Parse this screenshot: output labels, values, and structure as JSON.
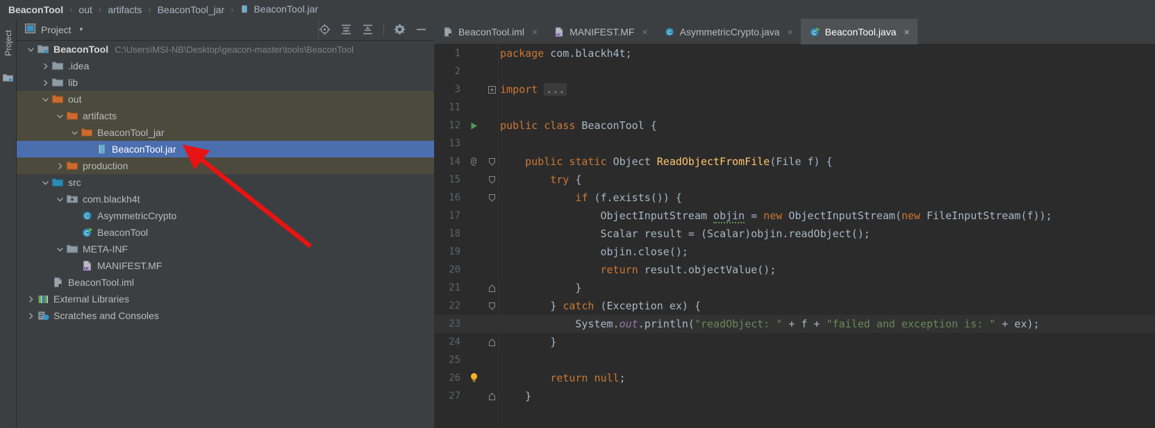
{
  "breadcrumb": {
    "items": [
      {
        "label": "BeaconTool",
        "bold": true,
        "icon": "none"
      },
      {
        "label": "out",
        "bold": false,
        "icon": "none"
      },
      {
        "label": "artifacts",
        "bold": false,
        "icon": "none"
      },
      {
        "label": "BeaconTool_jar",
        "bold": false,
        "icon": "none"
      },
      {
        "label": "BeaconTool.jar",
        "bold": false,
        "icon": "jar-icon"
      }
    ],
    "separator": "›"
  },
  "left_rail": {
    "label": "Project",
    "icon": "project-icon"
  },
  "project_panel": {
    "title": "Project",
    "dropdown_arrow": "▾",
    "toolbar_icons": [
      {
        "name": "locate-icon",
        "tooltip": "Select Opened File"
      },
      {
        "name": "expand-all-icon",
        "tooltip": "Expand All"
      },
      {
        "name": "collapse-all-icon",
        "tooltip": "Collapse All"
      },
      {
        "name": "gear-icon",
        "tooltip": "Settings"
      },
      {
        "name": "minimize-icon",
        "tooltip": "Hide"
      }
    ]
  },
  "tree": {
    "rows": [
      {
        "indent": 0,
        "arrow": "down",
        "icon": "module-icon",
        "label": "BeaconTool",
        "bold": true,
        "path": "C:\\Users\\MSI-NB\\Desktop\\geacon-master\\tools\\BeaconTool",
        "state": "normal"
      },
      {
        "indent": 1,
        "arrow": "right",
        "icon": "folder-gray",
        "label": ".idea",
        "bold": false,
        "path": "",
        "state": "normal"
      },
      {
        "indent": 1,
        "arrow": "right",
        "icon": "folder-gray",
        "label": "lib",
        "bold": false,
        "path": "",
        "state": "normal"
      },
      {
        "indent": 1,
        "arrow": "down",
        "icon": "folder-orange",
        "label": "out",
        "bold": false,
        "path": "",
        "state": "tint"
      },
      {
        "indent": 2,
        "arrow": "down",
        "icon": "folder-orange",
        "label": "artifacts",
        "bold": false,
        "path": "",
        "state": "tint"
      },
      {
        "indent": 3,
        "arrow": "down",
        "icon": "folder-orange",
        "label": "BeaconTool_jar",
        "bold": false,
        "path": "",
        "state": "tint"
      },
      {
        "indent": 4,
        "arrow": "none",
        "icon": "jar-icon",
        "label": "BeaconTool.jar",
        "bold": false,
        "path": "",
        "state": "selected"
      },
      {
        "indent": 2,
        "arrow": "right",
        "icon": "folder-orange",
        "label": "production",
        "bold": false,
        "path": "",
        "state": "tint"
      },
      {
        "indent": 1,
        "arrow": "down",
        "icon": "folder-blue",
        "label": "src",
        "bold": false,
        "path": "",
        "state": "normal"
      },
      {
        "indent": 2,
        "arrow": "down",
        "icon": "package-icon",
        "label": "com.blackh4t",
        "bold": false,
        "path": "",
        "state": "normal"
      },
      {
        "indent": 3,
        "arrow": "none",
        "icon": "class-icon",
        "label": "AsymmetricCrypto",
        "bold": false,
        "path": "",
        "state": "normal"
      },
      {
        "indent": 3,
        "arrow": "none",
        "icon": "class-run-icon",
        "label": "BeaconTool",
        "bold": false,
        "path": "",
        "state": "normal"
      },
      {
        "indent": 2,
        "arrow": "down",
        "icon": "folder-gray",
        "label": "META-INF",
        "bold": false,
        "path": "",
        "state": "normal"
      },
      {
        "indent": 3,
        "arrow": "none",
        "icon": "manifest-icon",
        "label": "MANIFEST.MF",
        "bold": false,
        "path": "",
        "state": "normal"
      },
      {
        "indent": 1,
        "arrow": "none",
        "icon": "iml-icon",
        "label": "BeaconTool.iml",
        "bold": false,
        "path": "",
        "state": "normal"
      },
      {
        "indent": 0,
        "arrow": "right",
        "icon": "libraries-icon",
        "label": "External Libraries",
        "bold": false,
        "path": "",
        "state": "normal"
      },
      {
        "indent": 0,
        "arrow": "right",
        "icon": "scratches-icon",
        "label": "Scratches and Consoles",
        "bold": false,
        "path": "",
        "state": "normal"
      }
    ]
  },
  "editor": {
    "tabs": [
      {
        "label": "BeaconTool.iml",
        "icon": "iml-icon",
        "active": false,
        "close": "×"
      },
      {
        "label": "MANIFEST.MF",
        "icon": "manifest-icon",
        "active": false,
        "close": "×"
      },
      {
        "label": "AsymmetricCrypto.java",
        "icon": "class-icon",
        "active": false,
        "close": "×"
      },
      {
        "label": "BeaconTool.java",
        "icon": "class-run-icon",
        "active": true,
        "close": "×"
      }
    ],
    "lines": [
      {
        "num": "1",
        "gutter": "",
        "fold": "",
        "current": false,
        "tokens": [
          {
            "t": "package ",
            "c": "kw"
          },
          {
            "t": "com.blackh4t;",
            "c": "plain"
          }
        ]
      },
      {
        "num": "2",
        "gutter": "",
        "fold": "",
        "current": false,
        "tokens": []
      },
      {
        "num": "3",
        "gutter": "",
        "fold": "plus",
        "current": false,
        "tokens": [
          {
            "t": "import ",
            "c": "kw"
          },
          {
            "t": "...",
            "c": "foldph"
          }
        ]
      },
      {
        "num": "11",
        "gutter": "",
        "fold": "",
        "current": false,
        "tokens": []
      },
      {
        "num": "12",
        "gutter": "run",
        "fold": "",
        "current": false,
        "tokens": [
          {
            "t": "public class ",
            "c": "kw"
          },
          {
            "t": "BeaconTool",
            "c": "cls"
          },
          {
            "t": " {",
            "c": "plain"
          }
        ]
      },
      {
        "num": "13",
        "gutter": "",
        "fold": "",
        "current": false,
        "tokens": []
      },
      {
        "num": "14",
        "gutter": "at",
        "fold": "down",
        "current": false,
        "tokens": [
          {
            "t": "    ",
            "c": "plain"
          },
          {
            "t": "public static ",
            "c": "kw"
          },
          {
            "t": "Object ",
            "c": "cls"
          },
          {
            "t": "ReadObjectFromFile",
            "c": "mth"
          },
          {
            "t": "(File f) {",
            "c": "plain"
          }
        ]
      },
      {
        "num": "15",
        "gutter": "",
        "fold": "down",
        "current": false,
        "tokens": [
          {
            "t": "        ",
            "c": "plain"
          },
          {
            "t": "try",
            "c": "kw"
          },
          {
            "t": " {",
            "c": "plain"
          }
        ]
      },
      {
        "num": "16",
        "gutter": "",
        "fold": "down",
        "current": false,
        "tokens": [
          {
            "t": "            ",
            "c": "plain"
          },
          {
            "t": "if",
            "c": "kw"
          },
          {
            "t": " (f.exists()) {",
            "c": "plain"
          }
        ]
      },
      {
        "num": "17",
        "gutter": "",
        "fold": "",
        "current": false,
        "tokens": [
          {
            "t": "                ObjectInputStream ",
            "c": "plain"
          },
          {
            "t": "objin",
            "c": "typo"
          },
          {
            "t": " = ",
            "c": "plain"
          },
          {
            "t": "new ",
            "c": "kw"
          },
          {
            "t": "ObjectInputStream(",
            "c": "plain"
          },
          {
            "t": "new ",
            "c": "kw"
          },
          {
            "t": "FileInputStream(f));",
            "c": "plain"
          }
        ]
      },
      {
        "num": "18",
        "gutter": "",
        "fold": "",
        "current": false,
        "tokens": [
          {
            "t": "                Scalar result = (Scalar)objin.readObject();",
            "c": "plain"
          }
        ]
      },
      {
        "num": "19",
        "gutter": "",
        "fold": "",
        "current": false,
        "tokens": [
          {
            "t": "                objin.close();",
            "c": "plain"
          }
        ]
      },
      {
        "num": "20",
        "gutter": "",
        "fold": "",
        "current": false,
        "tokens": [
          {
            "t": "                ",
            "c": "plain"
          },
          {
            "t": "return",
            "c": "kw"
          },
          {
            "t": " result.objectValue();",
            "c": "plain"
          }
        ]
      },
      {
        "num": "21",
        "gutter": "",
        "fold": "up",
        "current": false,
        "tokens": [
          {
            "t": "            }",
            "c": "plain"
          }
        ]
      },
      {
        "num": "22",
        "gutter": "",
        "fold": "down",
        "current": false,
        "tokens": [
          {
            "t": "        } ",
            "c": "plain"
          },
          {
            "t": "catch",
            "c": "kw"
          },
          {
            "t": " (Exception ex) {",
            "c": "plain"
          }
        ]
      },
      {
        "num": "23",
        "gutter": "",
        "fold": "",
        "current": true,
        "tokens": [
          {
            "t": "            System.",
            "c": "plain"
          },
          {
            "t": "out",
            "c": "fld"
          },
          {
            "t": ".println(",
            "c": "plain"
          },
          {
            "t": "\"readObject: \"",
            "c": "str"
          },
          {
            "t": " + f + ",
            "c": "plain"
          },
          {
            "t": "\"failed and exception is: \"",
            "c": "str"
          },
          {
            "t": " + ex);",
            "c": "plain"
          }
        ]
      },
      {
        "num": "24",
        "gutter": "",
        "fold": "up",
        "current": false,
        "tokens": [
          {
            "t": "        }",
            "c": "plain"
          }
        ]
      },
      {
        "num": "25",
        "gutter": "",
        "fold": "",
        "current": false,
        "tokens": []
      },
      {
        "num": "26",
        "gutter": "bulb",
        "fold": "",
        "current": false,
        "tokens": [
          {
            "t": "        ",
            "c": "plain"
          },
          {
            "t": "return null",
            "c": "kw"
          },
          {
            "t": ";",
            "c": "plain"
          }
        ]
      },
      {
        "num": "27",
        "gutter": "",
        "fold": "up",
        "current": false,
        "tokens": [
          {
            "t": "    }",
            "c": "plain"
          }
        ]
      }
    ]
  },
  "annotation": {
    "name": "red-arrow",
    "color": "#e81313",
    "points_to": "BeaconTool.jar"
  }
}
